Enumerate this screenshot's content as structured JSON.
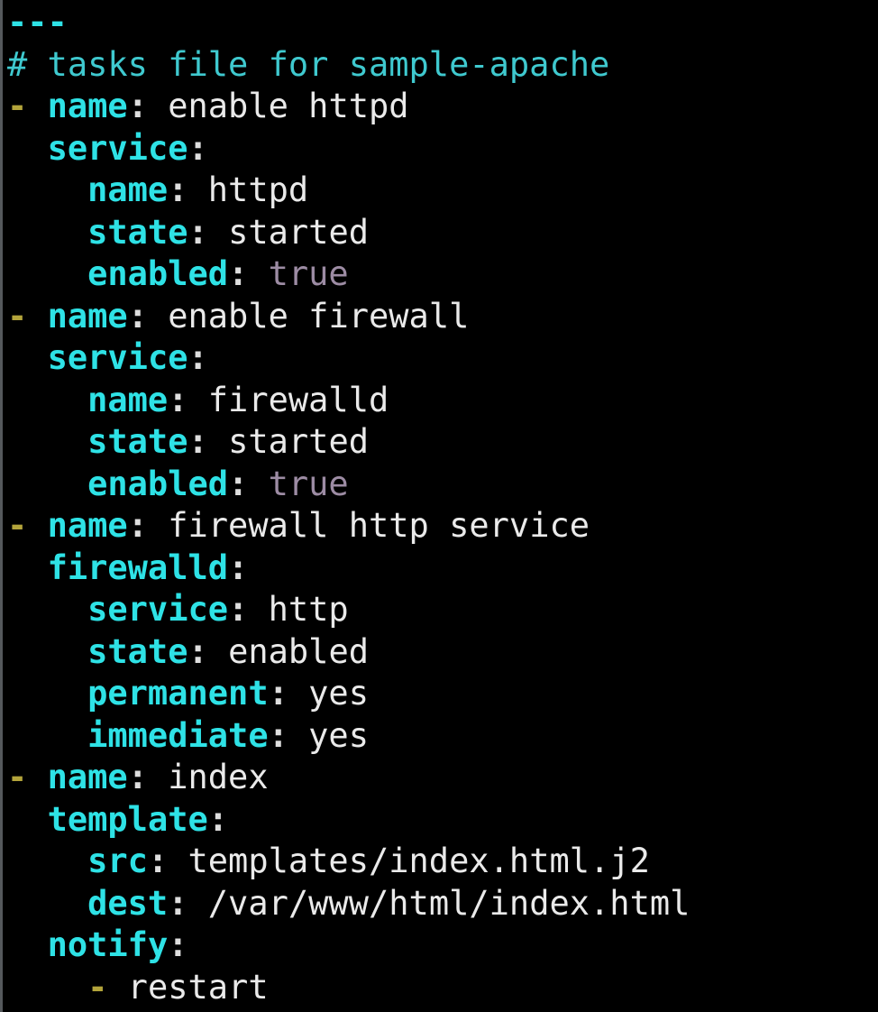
{
  "editor": {
    "filename": "tasks file for sample-apache",
    "language": "yaml",
    "background_color": "#000000",
    "colors": {
      "key": "#2ee2e6",
      "value": "#eaeaea",
      "comment": "#3fc9cf",
      "list_dash": "#b3a43b",
      "boolean": "#9d8ca4",
      "colon": "#dedede",
      "left_edge_strip": "#55595c"
    }
  },
  "lines": [
    {
      "indent": "",
      "tokens": [
        {
          "kind": "doc",
          "text": "---"
        }
      ]
    },
    {
      "indent": "",
      "tokens": [
        {
          "kind": "cmt",
          "text": "# tasks file for sample-apache"
        }
      ]
    },
    {
      "indent": "",
      "tokens": [
        {
          "kind": "dash",
          "text": "-"
        },
        {
          "kind": "ws",
          "text": " "
        },
        {
          "kind": "key",
          "text": "name"
        },
        {
          "kind": "colon",
          "text": ":"
        },
        {
          "kind": "ws",
          "text": " "
        },
        {
          "kind": "val",
          "text": "enable httpd"
        }
      ]
    },
    {
      "indent": "  ",
      "tokens": [
        {
          "kind": "key",
          "text": "service"
        },
        {
          "kind": "colon",
          "text": ":"
        }
      ]
    },
    {
      "indent": "    ",
      "tokens": [
        {
          "kind": "key",
          "text": "name"
        },
        {
          "kind": "colon",
          "text": ":"
        },
        {
          "kind": "ws",
          "text": " "
        },
        {
          "kind": "val",
          "text": "httpd"
        }
      ]
    },
    {
      "indent": "    ",
      "tokens": [
        {
          "kind": "key",
          "text": "state"
        },
        {
          "kind": "colon",
          "text": ":"
        },
        {
          "kind": "ws",
          "text": " "
        },
        {
          "kind": "val",
          "text": "started"
        }
      ]
    },
    {
      "indent": "    ",
      "tokens": [
        {
          "kind": "key",
          "text": "enabled"
        },
        {
          "kind": "colon",
          "text": ":"
        },
        {
          "kind": "ws",
          "text": " "
        },
        {
          "kind": "bool",
          "text": "true"
        }
      ]
    },
    {
      "indent": "",
      "tokens": [
        {
          "kind": "dash",
          "text": "-"
        },
        {
          "kind": "ws",
          "text": " "
        },
        {
          "kind": "key",
          "text": "name"
        },
        {
          "kind": "colon",
          "text": ":"
        },
        {
          "kind": "ws",
          "text": " "
        },
        {
          "kind": "val",
          "text": "enable firewall"
        }
      ]
    },
    {
      "indent": "  ",
      "tokens": [
        {
          "kind": "key",
          "text": "service"
        },
        {
          "kind": "colon",
          "text": ":"
        }
      ]
    },
    {
      "indent": "    ",
      "tokens": [
        {
          "kind": "key",
          "text": "name"
        },
        {
          "kind": "colon",
          "text": ":"
        },
        {
          "kind": "ws",
          "text": " "
        },
        {
          "kind": "val",
          "text": "firewalld"
        }
      ]
    },
    {
      "indent": "    ",
      "tokens": [
        {
          "kind": "key",
          "text": "state"
        },
        {
          "kind": "colon",
          "text": ":"
        },
        {
          "kind": "ws",
          "text": " "
        },
        {
          "kind": "val",
          "text": "started"
        }
      ]
    },
    {
      "indent": "    ",
      "tokens": [
        {
          "kind": "key",
          "text": "enabled"
        },
        {
          "kind": "colon",
          "text": ":"
        },
        {
          "kind": "ws",
          "text": " "
        },
        {
          "kind": "bool",
          "text": "true"
        }
      ]
    },
    {
      "indent": "",
      "tokens": [
        {
          "kind": "dash",
          "text": "-"
        },
        {
          "kind": "ws",
          "text": " "
        },
        {
          "kind": "key",
          "text": "name"
        },
        {
          "kind": "colon",
          "text": ":"
        },
        {
          "kind": "ws",
          "text": " "
        },
        {
          "kind": "val",
          "text": "firewall http service"
        }
      ]
    },
    {
      "indent": "  ",
      "tokens": [
        {
          "kind": "key",
          "text": "firewalld"
        },
        {
          "kind": "colon",
          "text": ":"
        }
      ]
    },
    {
      "indent": "    ",
      "tokens": [
        {
          "kind": "key",
          "text": "service"
        },
        {
          "kind": "colon",
          "text": ":"
        },
        {
          "kind": "ws",
          "text": " "
        },
        {
          "kind": "val",
          "text": "http"
        }
      ]
    },
    {
      "indent": "    ",
      "tokens": [
        {
          "kind": "key",
          "text": "state"
        },
        {
          "kind": "colon",
          "text": ":"
        },
        {
          "kind": "ws",
          "text": " "
        },
        {
          "kind": "val",
          "text": "enabled"
        }
      ]
    },
    {
      "indent": "    ",
      "tokens": [
        {
          "kind": "key",
          "text": "permanent"
        },
        {
          "kind": "colon",
          "text": ":"
        },
        {
          "kind": "ws",
          "text": " "
        },
        {
          "kind": "val",
          "text": "yes"
        }
      ]
    },
    {
      "indent": "    ",
      "tokens": [
        {
          "kind": "key",
          "text": "immediate"
        },
        {
          "kind": "colon",
          "text": ":"
        },
        {
          "kind": "ws",
          "text": " "
        },
        {
          "kind": "val",
          "text": "yes"
        }
      ]
    },
    {
      "indent": "",
      "tokens": [
        {
          "kind": "dash",
          "text": "-"
        },
        {
          "kind": "ws",
          "text": " "
        },
        {
          "kind": "key",
          "text": "name"
        },
        {
          "kind": "colon",
          "text": ":"
        },
        {
          "kind": "ws",
          "text": " "
        },
        {
          "kind": "val",
          "text": "index"
        }
      ]
    },
    {
      "indent": "  ",
      "tokens": [
        {
          "kind": "key",
          "text": "template"
        },
        {
          "kind": "colon",
          "text": ":"
        }
      ]
    },
    {
      "indent": "    ",
      "tokens": [
        {
          "kind": "key",
          "text": "src"
        },
        {
          "kind": "colon",
          "text": ":"
        },
        {
          "kind": "ws",
          "text": " "
        },
        {
          "kind": "val",
          "text": "templates/index.html.j2"
        }
      ]
    },
    {
      "indent": "    ",
      "tokens": [
        {
          "kind": "key",
          "text": "dest"
        },
        {
          "kind": "colon",
          "text": ":"
        },
        {
          "kind": "ws",
          "text": " "
        },
        {
          "kind": "val",
          "text": "/var/www/html/index.html"
        }
      ]
    },
    {
      "indent": "  ",
      "tokens": [
        {
          "kind": "key",
          "text": "notify"
        },
        {
          "kind": "colon",
          "text": ":"
        }
      ]
    },
    {
      "indent": "    ",
      "tokens": [
        {
          "kind": "dash",
          "text": "-"
        },
        {
          "kind": "ws",
          "text": " "
        },
        {
          "kind": "val",
          "text": "restart"
        }
      ]
    }
  ]
}
